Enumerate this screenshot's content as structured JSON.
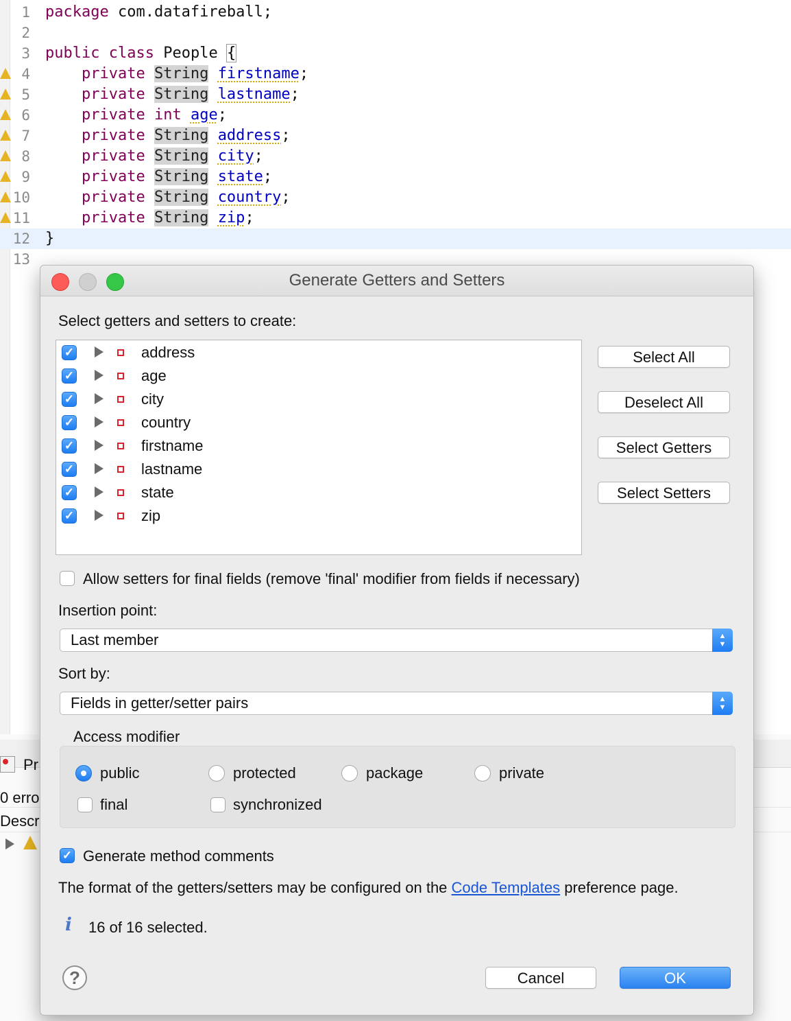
{
  "editor": {
    "lines": [
      {
        "n": "1",
        "tokens": [
          {
            "c": "kw",
            "t": "package"
          },
          {
            "c": "plain",
            "t": " com.datafireball;"
          }
        ]
      },
      {
        "n": "2",
        "tokens": []
      },
      {
        "n": "3",
        "tokens": [
          {
            "c": "kw",
            "t": "public"
          },
          {
            "c": "plain",
            "t": " "
          },
          {
            "c": "kw",
            "t": "class"
          },
          {
            "c": "plain",
            "t": " People "
          },
          {
            "c": "brace",
            "t": "{"
          }
        ]
      },
      {
        "n": "4",
        "warn": true,
        "tokens": [
          {
            "c": "plain",
            "t": "    "
          },
          {
            "c": "kw",
            "t": "private"
          },
          {
            "c": "plain",
            "t": " "
          },
          {
            "c": "ty",
            "t": "String"
          },
          {
            "c": "plain",
            "t": " "
          },
          {
            "c": "fld",
            "t": "firstname"
          },
          {
            "c": "plain",
            "t": ";"
          }
        ]
      },
      {
        "n": "5",
        "warn": true,
        "tokens": [
          {
            "c": "plain",
            "t": "    "
          },
          {
            "c": "kw",
            "t": "private"
          },
          {
            "c": "plain",
            "t": " "
          },
          {
            "c": "ty",
            "t": "String"
          },
          {
            "c": "plain",
            "t": " "
          },
          {
            "c": "fld",
            "t": "lastname"
          },
          {
            "c": "plain",
            "t": ";"
          }
        ]
      },
      {
        "n": "6",
        "warn": true,
        "tokens": [
          {
            "c": "plain",
            "t": "    "
          },
          {
            "c": "kw",
            "t": "private"
          },
          {
            "c": "plain",
            "t": " "
          },
          {
            "c": "kw",
            "t": "int"
          },
          {
            "c": "plain",
            "t": " "
          },
          {
            "c": "fld",
            "t": "age"
          },
          {
            "c": "plain",
            "t": ";"
          }
        ]
      },
      {
        "n": "7",
        "warn": true,
        "tokens": [
          {
            "c": "plain",
            "t": "    "
          },
          {
            "c": "kw",
            "t": "private"
          },
          {
            "c": "plain",
            "t": " "
          },
          {
            "c": "ty",
            "t": "String"
          },
          {
            "c": "plain",
            "t": " "
          },
          {
            "c": "fld",
            "t": "address"
          },
          {
            "c": "plain",
            "t": ";"
          }
        ]
      },
      {
        "n": "8",
        "warn": true,
        "tokens": [
          {
            "c": "plain",
            "t": "    "
          },
          {
            "c": "kw",
            "t": "private"
          },
          {
            "c": "plain",
            "t": " "
          },
          {
            "c": "ty",
            "t": "String"
          },
          {
            "c": "plain",
            "t": " "
          },
          {
            "c": "fld",
            "t": "city"
          },
          {
            "c": "plain",
            "t": ";"
          }
        ]
      },
      {
        "n": "9",
        "warn": true,
        "tokens": [
          {
            "c": "plain",
            "t": "    "
          },
          {
            "c": "kw",
            "t": "private"
          },
          {
            "c": "plain",
            "t": " "
          },
          {
            "c": "ty",
            "t": "String"
          },
          {
            "c": "plain",
            "t": " "
          },
          {
            "c": "fld",
            "t": "state"
          },
          {
            "c": "plain",
            "t": ";"
          }
        ]
      },
      {
        "n": "10",
        "warn": true,
        "tokens": [
          {
            "c": "plain",
            "t": "    "
          },
          {
            "c": "kw",
            "t": "private"
          },
          {
            "c": "plain",
            "t": " "
          },
          {
            "c": "ty",
            "t": "String"
          },
          {
            "c": "plain",
            "t": " "
          },
          {
            "c": "fld",
            "t": "country"
          },
          {
            "c": "plain",
            "t": ";"
          }
        ]
      },
      {
        "n": "11",
        "warn": true,
        "tokens": [
          {
            "c": "plain",
            "t": "    "
          },
          {
            "c": "kw",
            "t": "private"
          },
          {
            "c": "plain",
            "t": " "
          },
          {
            "c": "ty",
            "t": "String"
          },
          {
            "c": "plain",
            "t": " "
          },
          {
            "c": "fld",
            "t": "zip"
          },
          {
            "c": "plain",
            "t": ";"
          }
        ]
      },
      {
        "n": "12",
        "current": true,
        "tokens": [
          {
            "c": "plain",
            "t": "}"
          }
        ]
      },
      {
        "n": "13",
        "tokens": []
      }
    ]
  },
  "background": {
    "problems_tab": "Pr",
    "errors": "0 error",
    "description": "Descri"
  },
  "dialog": {
    "title": "Generate Getters and Setters",
    "select_label": "Select getters and setters to create:",
    "fields": [
      {
        "name": "address",
        "checked": true
      },
      {
        "name": "age",
        "checked": true
      },
      {
        "name": "city",
        "checked": true
      },
      {
        "name": "country",
        "checked": true
      },
      {
        "name": "firstname",
        "checked": true
      },
      {
        "name": "lastname",
        "checked": true
      },
      {
        "name": "state",
        "checked": true
      },
      {
        "name": "zip",
        "checked": true
      }
    ],
    "buttons": {
      "select_all": "Select All",
      "deselect_all": "Deselect All",
      "select_getters": "Select Getters",
      "select_setters": "Select Setters",
      "cancel": "Cancel",
      "ok": "OK"
    },
    "allow_setters_final": {
      "label": "Allow setters for final fields (remove 'final' modifier from fields if necessary)",
      "checked": false
    },
    "insertion_point": {
      "label": "Insertion point:",
      "value": "Last member"
    },
    "sort_by": {
      "label": "Sort by:",
      "value": "Fields in getter/setter pairs"
    },
    "access_modifier": {
      "label": "Access modifier",
      "options": [
        "public",
        "protected",
        "package",
        "private"
      ],
      "selected": "public",
      "final": {
        "label": "final",
        "checked": false
      },
      "synchronized": {
        "label": "synchronized",
        "checked": false
      }
    },
    "generate_comments": {
      "label": "Generate method comments",
      "checked": true
    },
    "format_text_before": "The format of the getters/setters may be configured on the ",
    "format_link": "Code Templates",
    "format_text_after": " preference page.",
    "status": "16 of 16 selected.",
    "info_icon": "i",
    "help_icon": "?"
  },
  "colors": {
    "accent": "#1f7df2",
    "keyword": "#7f0055",
    "field": "#0000c0",
    "close": "#fc5b57",
    "maximize": "#34c748"
  }
}
